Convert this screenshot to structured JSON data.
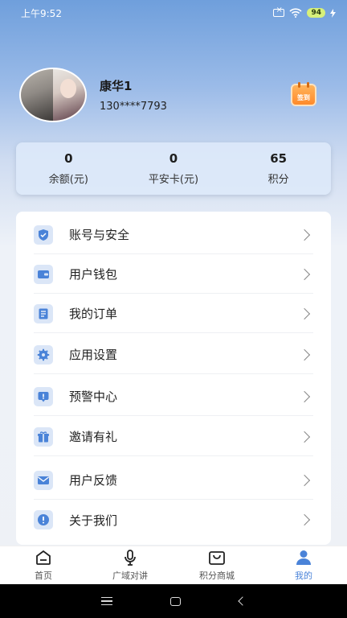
{
  "status": {
    "time": "上午9:52",
    "battery": "94"
  },
  "profile": {
    "name": "康华1",
    "phone": "130****7793",
    "signin_label": "签到"
  },
  "stats": [
    {
      "value": "0",
      "label": "余额(元)"
    },
    {
      "value": "0",
      "label": "平安卡(元)"
    },
    {
      "value": "65",
      "label": "积分"
    }
  ],
  "menu": [
    {
      "label": "账号与安全",
      "icon": "shield-icon"
    },
    {
      "label": "用户钱包",
      "icon": "wallet-icon"
    },
    {
      "label": "我的订单",
      "icon": "order-icon"
    },
    {
      "label": "应用设置",
      "icon": "gear-icon"
    },
    {
      "label": "预警中心",
      "icon": "alert-icon"
    },
    {
      "label": "邀请有礼",
      "icon": "gift-icon"
    },
    {
      "label": "用户反馈",
      "icon": "mail-icon"
    },
    {
      "label": "关于我们",
      "icon": "info-icon"
    }
  ],
  "tabs": [
    {
      "label": "首页",
      "icon": "home-icon"
    },
    {
      "label": "广域对讲",
      "icon": "microphone-icon"
    },
    {
      "label": "积分商城",
      "icon": "shopping-bag-icon"
    },
    {
      "label": "我的",
      "icon": "user-icon",
      "active": true
    }
  ],
  "colors": {
    "accent": "#4a83d8",
    "icon_bg": "#dbe6f7"
  }
}
